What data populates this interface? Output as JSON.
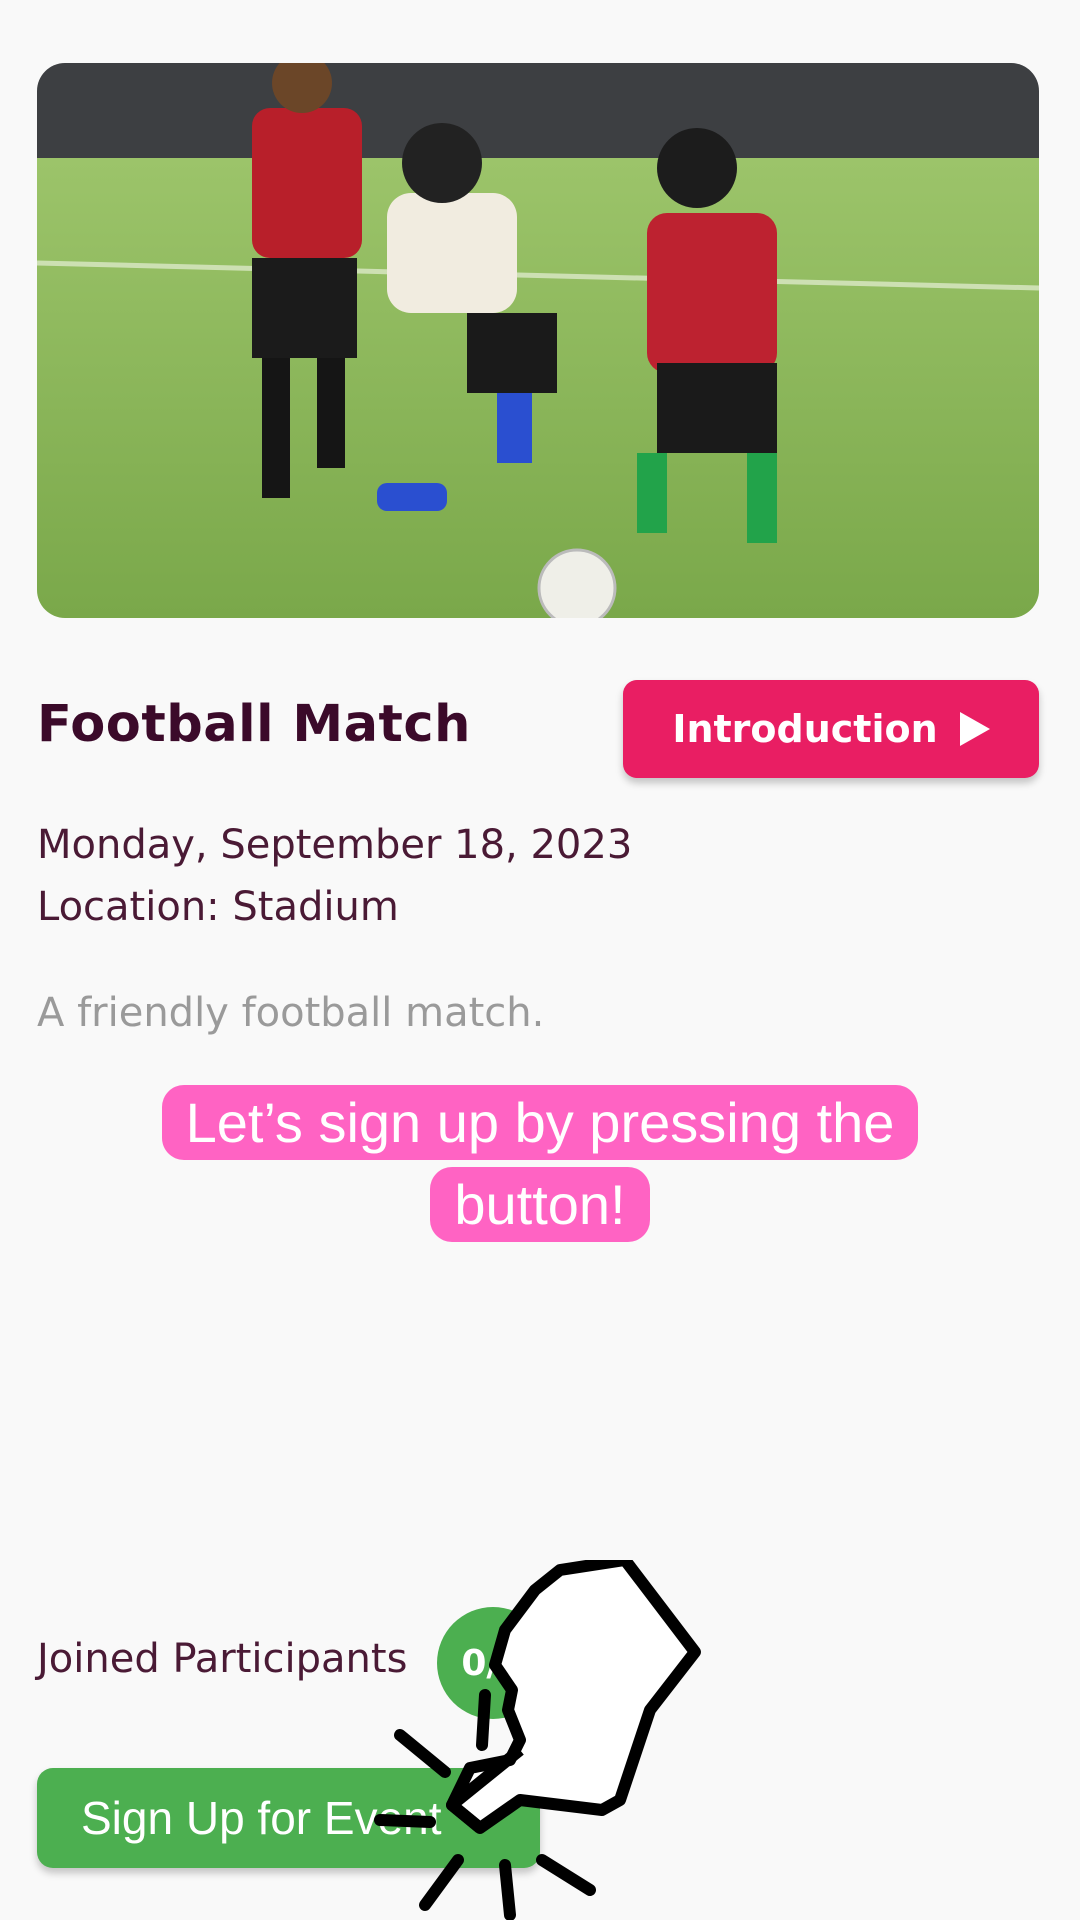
{
  "event": {
    "title": "Football Match",
    "date": "Monday, September 18, 2023",
    "location": "Location: Stadium",
    "description": "A friendly football match."
  },
  "intro_button": {
    "label": "Introduction",
    "icon": "play-icon"
  },
  "tutorial": {
    "callout": "Let’s sign up by pressing the button!"
  },
  "participants": {
    "label": "Joined Participants",
    "count": "0/2"
  },
  "signup_button": {
    "label": "Sign Up for Event"
  },
  "colors": {
    "accent_pink": "#e91e63",
    "callout_pink": "#ff63c3",
    "success_green": "#4caf50",
    "title_text": "#3b0a2a"
  }
}
